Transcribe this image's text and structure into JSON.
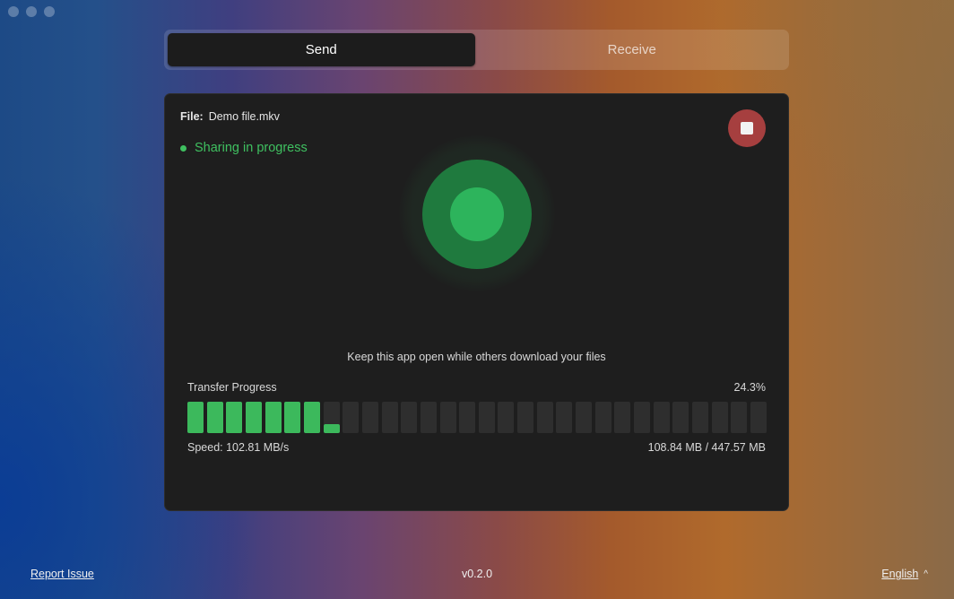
{
  "tabs": [
    {
      "label": "Send",
      "active": true
    },
    {
      "label": "Receive",
      "active": false
    }
  ],
  "file": {
    "label": "File:",
    "name": "Demo file.mkv"
  },
  "status": {
    "text": "Sharing in progress",
    "color": "#3fc060"
  },
  "stop_button": {
    "icon": "stop-icon",
    "color": "#a63f3f"
  },
  "hint": "Keep this app open while others download your files",
  "progress": {
    "label": "Transfer Progress",
    "percent_text": "24.3%",
    "fraction": 0.243,
    "segments": 30,
    "fill_color": "#3cb95c"
  },
  "speed": "Speed: 102.81 MB/s",
  "size": "108.84 MB / 447.57 MB",
  "footer": {
    "report_issue": "Report Issue",
    "version": "v0.2.0",
    "language": "English",
    "language_icon": "chevron-up-icon"
  }
}
